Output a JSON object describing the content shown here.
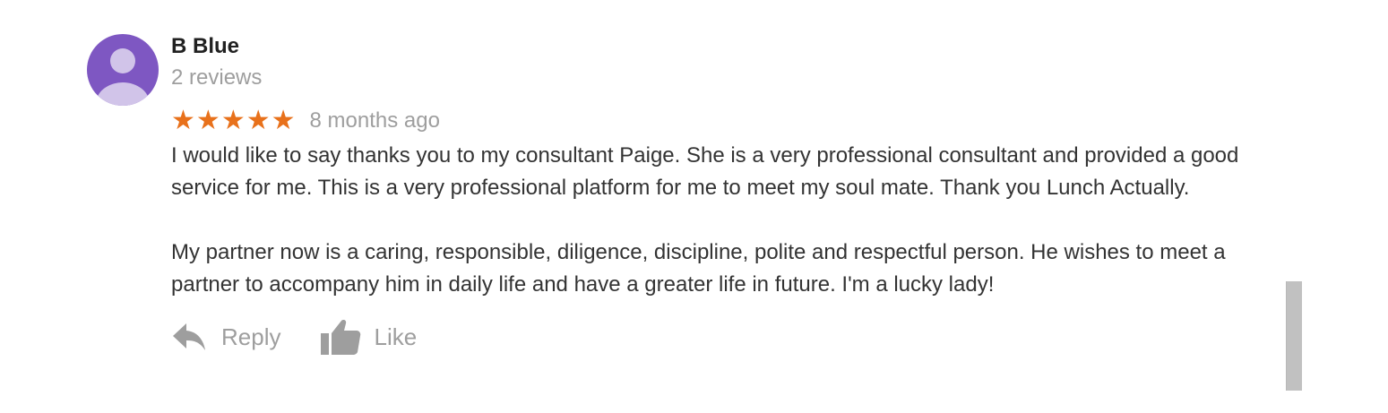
{
  "author": {
    "name": "B Blue",
    "review_count": "2 reviews",
    "avatar_color": "#7e57c2",
    "avatar_icon": "default-user-silhouette"
  },
  "rating": {
    "stars": 5,
    "max_stars": 5,
    "star_color": "#e8711b",
    "time_ago": "8 months ago"
  },
  "review": {
    "paragraphs": [
      "I would like to say thanks you to my consultant Paige. She is a very professional consultant and provided a good service for me. This is a very professional platform for me to meet my soul mate. Thank you Lunch Actually.",
      "My partner now is a caring, responsible, diligence, discipline, polite and respectful person. He wishes to meet a partner to accompany him in daily life and have a greater life in future. I'm a lucky lady!"
    ]
  },
  "actions": {
    "reply_label": "Reply",
    "reply_icon": "reply-arrow-icon",
    "like_label": "Like",
    "like_icon": "thumbs-up-icon"
  }
}
